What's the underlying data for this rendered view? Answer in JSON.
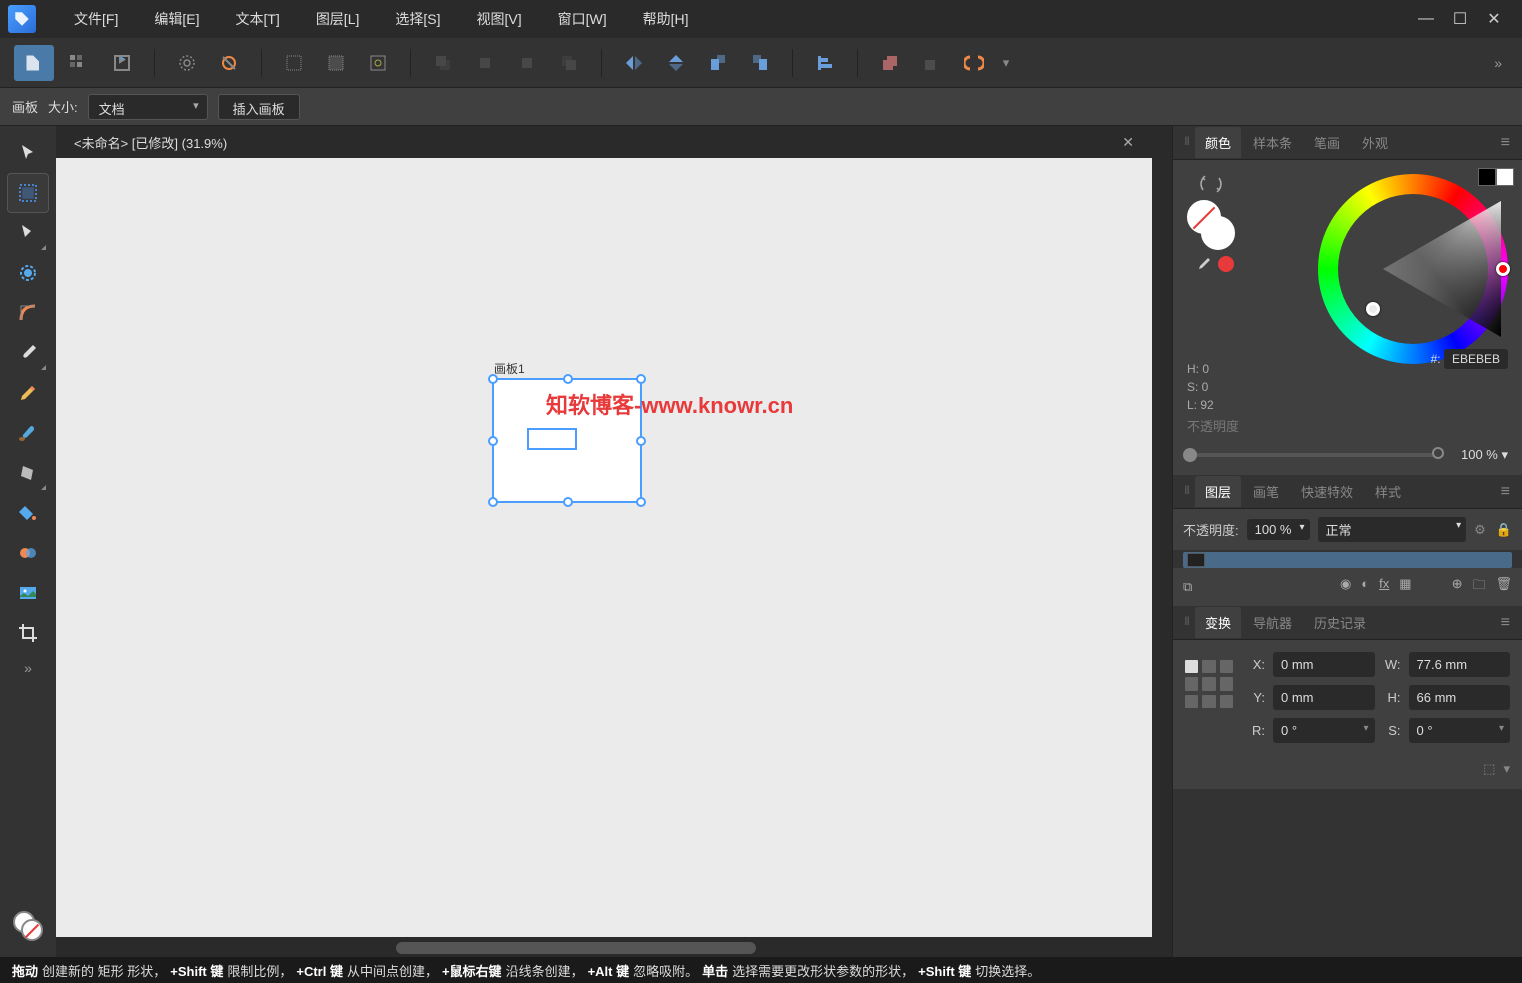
{
  "menu": {
    "file": "文件[F]",
    "edit": "编辑[E]",
    "text": "文本[T]",
    "layer": "图层[L]",
    "select": "选择[S]",
    "view": "视图[V]",
    "window": "窗口[W]",
    "help": "帮助[H]"
  },
  "context": {
    "label_artboard": "画板",
    "label_size": "大小:",
    "size_value": "文档",
    "insert_btn": "插入画板"
  },
  "doc": {
    "title": "<未命名> [已修改] (31.9%)",
    "artboard_label": "画板1"
  },
  "watermark": "知软博客-www.knowr.cn",
  "color": {
    "tab_color": "颜色",
    "tab_swatches": "样本条",
    "tab_stroke": "笔画",
    "tab_appearance": "外观",
    "h": "H: 0",
    "s": "S: 0",
    "l": "L: 92",
    "hex_label": "#:",
    "hex": "EBEBEB",
    "opacity_label": "不透明度",
    "opacity_value": "100 %"
  },
  "layers": {
    "tab_layers": "图层",
    "tab_brushes": "画笔",
    "tab_effects": "快速特效",
    "tab_styles": "样式",
    "opacity_label": "不透明度:",
    "opacity_value": "100 %",
    "blend": "正常"
  },
  "transform": {
    "tab_transform": "变换",
    "tab_navigator": "导航器",
    "tab_history": "历史记录",
    "x_label": "X:",
    "x": "0 mm",
    "w_label": "W:",
    "w": "77.6 mm",
    "y_label": "Y:",
    "y": "0 mm",
    "h_label": "H:",
    "h": "66 mm",
    "r_label": "R:",
    "r": "0 °",
    "s_label": "S:",
    "s": "0 °"
  },
  "status": {
    "s1": "拖动",
    "s2": " 创建新的 矩形 形状，",
    "s3": "+Shift 键",
    "s4": " 限制比例，",
    "s5": "+Ctrl 键",
    "s6": " 从中间点创建，",
    "s7": "+鼠标右键",
    "s8": " 沿线条创建，",
    "s9": "+Alt 键",
    "s10": " 忽略吸附。",
    "s11": "单击",
    "s12": " 选择需要更改形状参数的形状，",
    "s13": "+Shift 键",
    "s14": " 切换选择。"
  }
}
